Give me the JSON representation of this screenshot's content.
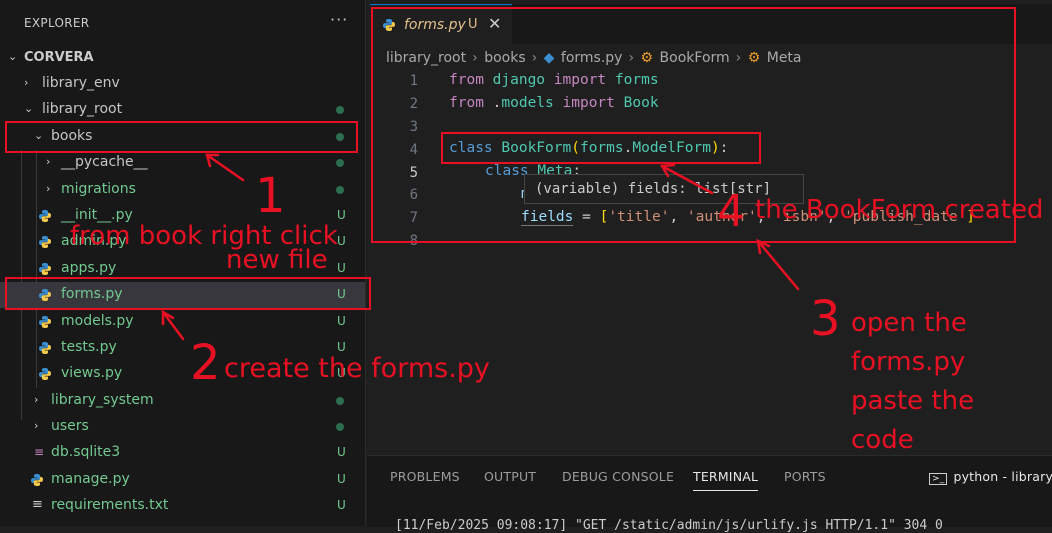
{
  "explorer": {
    "title": "EXPLORER",
    "more": "···",
    "root": "CORVERA",
    "items": [
      {
        "label": "library_env",
        "badge": ""
      },
      {
        "label": "library_root",
        "badge": ""
      },
      {
        "label": "books",
        "badge": ""
      },
      {
        "label": "__pycache__",
        "badge": ""
      },
      {
        "label": "migrations",
        "badge": ""
      },
      {
        "label": "__init__.py",
        "badge": "U"
      },
      {
        "label": "admin.py",
        "badge": "U"
      },
      {
        "label": "apps.py",
        "badge": "U"
      },
      {
        "label": "forms.py",
        "badge": "U"
      },
      {
        "label": "models.py",
        "badge": "U"
      },
      {
        "label": "tests.py",
        "badge": "U"
      },
      {
        "label": "views.py",
        "badge": "U"
      },
      {
        "label": "library_system",
        "badge": ""
      },
      {
        "label": "users",
        "badge": ""
      },
      {
        "label": "db.sqlite3",
        "badge": "U"
      },
      {
        "label": "manage.py",
        "badge": "U"
      },
      {
        "label": "requirements.txt",
        "badge": "U"
      }
    ]
  },
  "editor": {
    "tab": {
      "name": "forms.py",
      "badge": "U",
      "close": "✕"
    },
    "breadcrumb": [
      "library_root",
      "books",
      "forms.py",
      "BookForm",
      "Meta"
    ],
    "line_numbers": [
      "1",
      "2",
      "3",
      "4",
      "5",
      "6",
      "7",
      "8"
    ],
    "hover": "(variable) fields: list[str]"
  },
  "panel": {
    "tabs": [
      "PROBLEMS",
      "OUTPUT",
      "DEBUG CONSOLE",
      "TERMINAL",
      "PORTS"
    ],
    "active_tab": "TERMINAL",
    "terminal_label": "python - library_r",
    "terminal_line": "[11/Feb/2025 09:08:17] \"GET /static/admin/js/urlify.js HTTP/1.1\" 304 0"
  },
  "annotations": {
    "n1": "1",
    "t1a": "from book right click",
    "t1b": "new file",
    "n2": "2",
    "t2": "create the forms.py",
    "n3": "3",
    "t3": [
      "open the",
      "forms.py",
      "paste the",
      "code"
    ],
    "n4": "4",
    "t4": "the BookForm created"
  },
  "colors": {
    "annotation": "#e81123",
    "accent": "#0078d4",
    "untracked": "#73c991"
  }
}
